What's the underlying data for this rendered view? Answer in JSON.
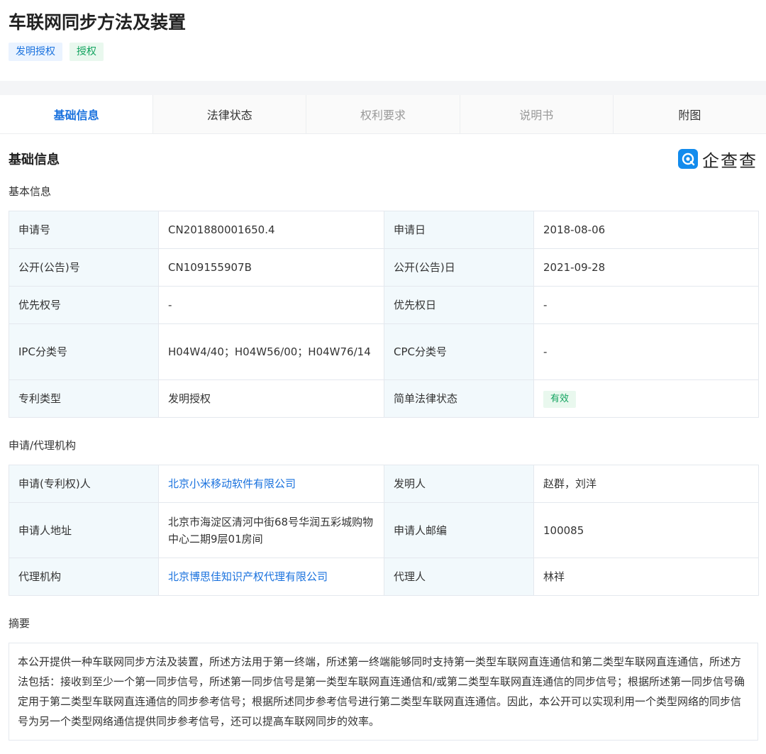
{
  "page": {
    "title": "车联网同步方法及装置",
    "tags": [
      "发明授权",
      "授权"
    ]
  },
  "tabs": [
    {
      "label": "基础信息",
      "state": "active"
    },
    {
      "label": "法律状态",
      "state": "normal"
    },
    {
      "label": "权利要求",
      "state": "disabled"
    },
    {
      "label": "说明书",
      "state": "disabled"
    },
    {
      "label": "附图",
      "state": "normal"
    }
  ],
  "section": {
    "title": "基础信息",
    "brand": "企查查"
  },
  "basic_info": {
    "title": "基本信息",
    "rows": [
      [
        "申请号",
        "CN201880001650.4",
        "申请日",
        "2018-08-06"
      ],
      [
        "公开(公告)号",
        "CN109155907B",
        "公开(公告)日",
        "2021-09-28"
      ],
      [
        "优先权号",
        "-",
        "优先权日",
        "-"
      ],
      [
        "IPC分类号",
        "H04W4/40；H04W56/00；H04W76/14",
        "CPC分类号",
        "-"
      ],
      [
        "专利类型",
        "发明授权",
        "简单法律状态",
        "有效"
      ]
    ]
  },
  "agency_info": {
    "title": "申请/代理机构",
    "rows": [
      [
        "申请(专利权)人",
        "北京小米移动软件有限公司",
        "发明人",
        "赵群，刘洋"
      ],
      [
        "申请人地址",
        "北京市海淀区清河中街68号华润五彩城购物中心二期9层01房间",
        "申请人邮编",
        "100085"
      ],
      [
        "代理机构",
        "北京博思佳知识产权代理有限公司",
        "代理人",
        "林祥"
      ]
    ]
  },
  "abstract": {
    "title": "摘要",
    "text": "本公开提供一种车联网同步方法及装置，所述方法用于第一终端，所述第一终端能够同时支持第一类型车联网直连通信和第二类型车联网直连通信，所述方法包括：接收到至少一个第一同步信号，所述第一同步信号是第一类型车联网直连通信和/或第二类型车联网直连通信的同步信号；根据所述第一同步信号确定用于第二类型车联网直连通信的同步参考信号；根据所述同步参考信号进行第二类型车联网直连通信。因此，本公开可以实现利用一个类型网络的同步信号为另一个类型网络通信提供同步参考信号，还可以提高车联网同步的效率。"
  },
  "colors": {
    "accent": "#1a72de",
    "status_green": "#12a35f",
    "label_bg": "#f2f9fc",
    "brand": "#128bed"
  }
}
